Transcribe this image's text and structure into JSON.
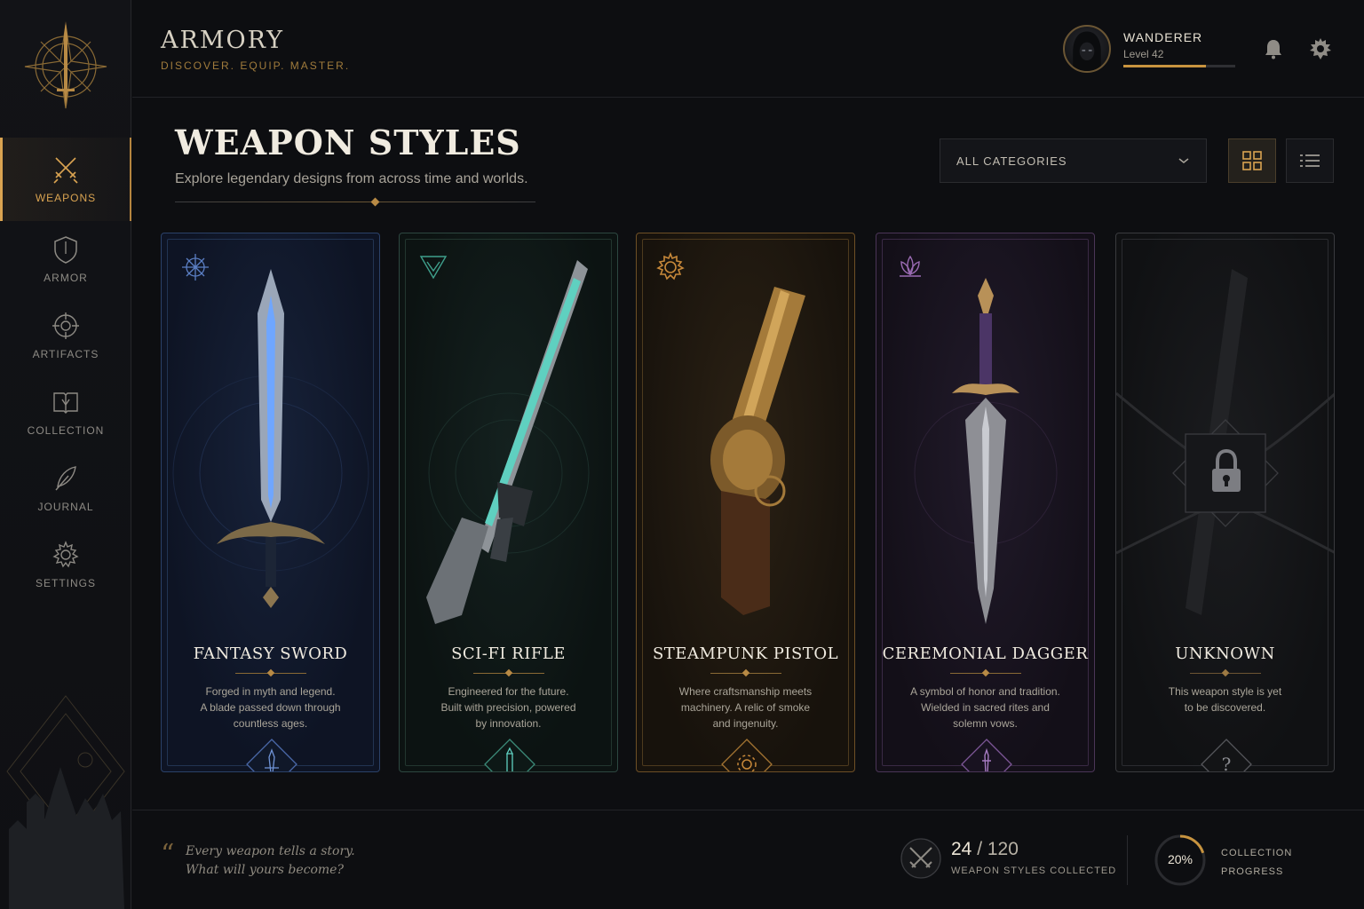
{
  "app": {
    "title": "ARMORY",
    "tagline": "DISCOVER. EQUIP. MASTER."
  },
  "sidebar": {
    "items": [
      {
        "label": "WEAPONS",
        "icon": "crossed-swords-icon",
        "active": true
      },
      {
        "label": "ARMOR",
        "icon": "shield-icon",
        "active": false
      },
      {
        "label": "ARTIFACTS",
        "icon": "crosshair-rune-icon",
        "active": false
      },
      {
        "label": "COLLECTION",
        "icon": "book-icon",
        "active": false
      },
      {
        "label": "JOURNAL",
        "icon": "feather-quill-icon",
        "active": false
      },
      {
        "label": "SETTINGS",
        "icon": "gear-icon",
        "active": false
      }
    ]
  },
  "profile": {
    "name": "WANDERER",
    "level": "Level 42",
    "xp_fraction": 0.74
  },
  "header_icons": [
    "bell-icon",
    "gear-icon"
  ],
  "section": {
    "title": "WEAPON STYLES",
    "subtitle": "Explore legendary designs from across time and worlds."
  },
  "filter": {
    "selected": "ALL CATEGORIES"
  },
  "view_toggle": {
    "active": "grid"
  },
  "cards": [
    {
      "title": "FANTASY SWORD",
      "description": [
        "Forged in myth and legend.",
        "A blade passed down through",
        "countless ages."
      ],
      "emblem": "rune-star-icon",
      "badge": "sword-badge-icon",
      "accent": "#5b7fc4"
    },
    {
      "title": "SCI-FI RIFLE",
      "description": [
        "Engineered for the future.",
        "Built with precision, powered",
        "by innovation."
      ],
      "emblem": "triangle-tech-icon",
      "badge": "cartridge-badge-icon",
      "accent": "#3fa08c"
    },
    {
      "title": "STEAMPUNK PISTOL",
      "description": [
        "Where craftsmanship meets",
        "machinery. A relic of smoke",
        "and ingenuity."
      ],
      "emblem": "cog-icon",
      "badge": "cog-badge-icon",
      "accent": "#c8893a"
    },
    {
      "title": "CEREMONIAL DAGGER",
      "description": [
        "A symbol of honor and tradition.",
        "Wielded in sacred rites and",
        "solemn vows."
      ],
      "emblem": "lotus-icon",
      "badge": "dagger-badge-icon",
      "accent": "#9a6bb3"
    },
    {
      "title": "UNKNOWN",
      "description": [
        "This weapon style is yet",
        "to be discovered."
      ],
      "emblem": "",
      "badge": "question-badge-icon",
      "accent": "#6d6e72",
      "locked": true
    }
  ],
  "footer": {
    "quote": [
      "Every weapon tells a story.",
      "What will yours become?"
    ],
    "collected": "24",
    "total": "120",
    "collected_label": "WEAPON STYLES COLLECTED",
    "progress_text": "20%",
    "progress_value": 0.2,
    "progress_label": [
      "COLLECTION",
      "PROGRESS"
    ]
  },
  "colors": {
    "accent_gold": "#d9a351",
    "background": "#0d0e11"
  }
}
